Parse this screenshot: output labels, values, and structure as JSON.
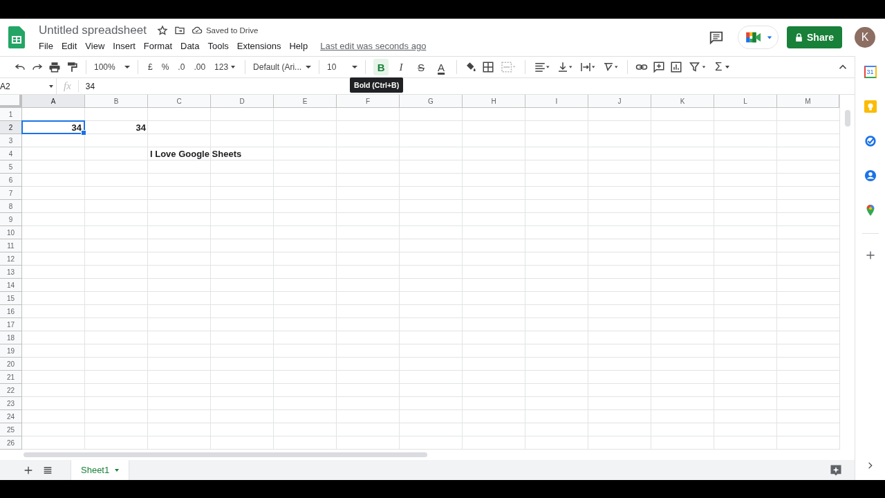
{
  "document": {
    "title": "Untitled spreadsheet",
    "save_status": "Saved to Drive",
    "last_edit": "Last edit was seconds ago"
  },
  "menu": [
    "File",
    "Edit",
    "View",
    "Insert",
    "Format",
    "Data",
    "Tools",
    "Extensions",
    "Help"
  ],
  "share_button": "Share",
  "avatar": "K",
  "toolbar": {
    "zoom": "100%",
    "currency": "£",
    "percent": "%",
    "decrease_decimals": ".0",
    "increase_decimals": ".00",
    "number_format": "123",
    "font": "Default (Ari...",
    "font_size": "10",
    "text_styles": [
      {
        "label": "B",
        "kind": "bold",
        "on": true
      },
      {
        "label": "I",
        "kind": "italic",
        "on": false
      },
      {
        "label": "S",
        "kind": "strike",
        "on": false
      },
      {
        "label": "A",
        "kind": "color",
        "on": false
      }
    ],
    "functions": "Σ",
    "tooltip": "Bold (Ctrl+B)"
  },
  "formula_bar": {
    "cell_reference": "A2",
    "fx": "fx",
    "value": "34"
  },
  "columns": [
    "A",
    "B",
    "C",
    "D",
    "E",
    "F",
    "G",
    "H",
    "I",
    "J",
    "K",
    "L",
    "M"
  ],
  "rows": [
    {
      "label": "1"
    },
    {
      "label": "2",
      "cells": [
        {
          "value": "34",
          "kind": "number",
          "bold": true,
          "selected": true
        },
        {
          "value": "34",
          "kind": "number",
          "bold": true,
          "selected": false
        }
      ]
    },
    {
      "label": "3"
    },
    {
      "label": "4",
      "cells": [
        {
          "selected": false
        },
        {
          "selected": false
        },
        {
          "value": "I Love Google Sheets",
          "kind": "text",
          "bold": true,
          "selected": false
        }
      ]
    },
    {
      "label": "5"
    },
    {
      "label": "6"
    },
    {
      "label": "7"
    },
    {
      "label": "8"
    },
    {
      "label": "9"
    },
    {
      "label": "10"
    },
    {
      "label": "11"
    },
    {
      "label": "12"
    },
    {
      "label": "13"
    },
    {
      "label": "14"
    },
    {
      "label": "15"
    },
    {
      "label": "16"
    },
    {
      "label": "17"
    },
    {
      "label": "18"
    },
    {
      "label": "19"
    },
    {
      "label": "20"
    },
    {
      "label": "21"
    },
    {
      "label": "22"
    },
    {
      "label": "23"
    },
    {
      "label": "24"
    },
    {
      "label": "25"
    },
    {
      "label": "26"
    }
  ],
  "sheet_tabs": [
    {
      "label": "Sheet1",
      "selected": true
    }
  ],
  "side_panel": {
    "calendar_day": "31"
  }
}
